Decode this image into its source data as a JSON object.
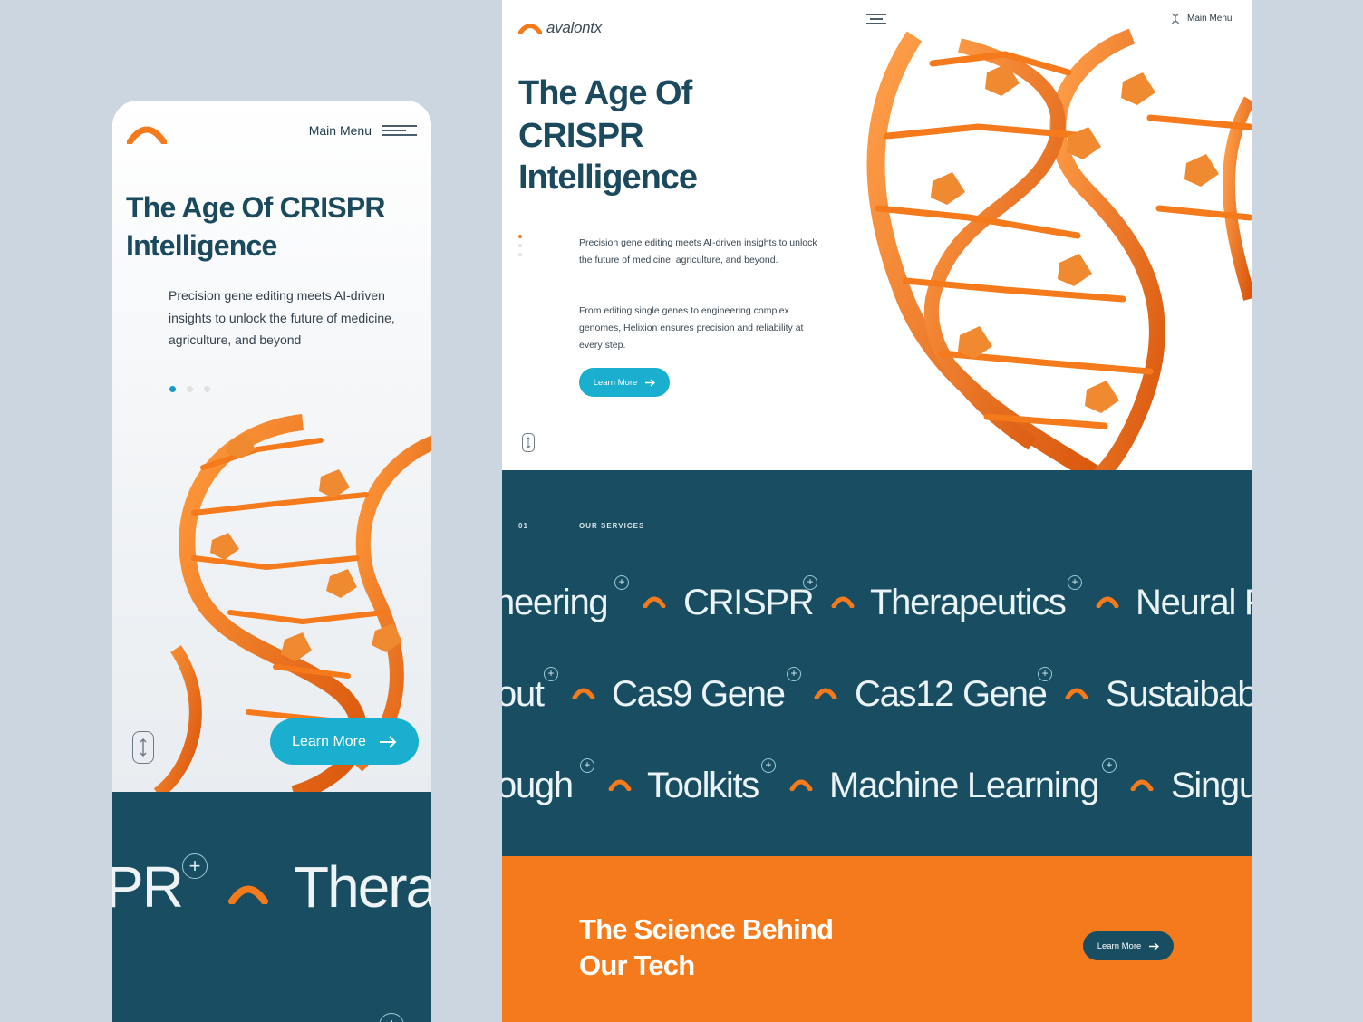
{
  "colors": {
    "orange": "#f47a1b",
    "teal_dark": "#184d62",
    "cyan": "#1aaecf",
    "heading": "#1b4a5e",
    "background": "#ccd6e0"
  },
  "mobile": {
    "logo_icon": "arch-logo-icon",
    "menu_label": "Main Menu",
    "menu_icon": "hamburger-icon",
    "title": "The Age Of CRISPR Intelligence",
    "description": "Precision gene editing meets AI-driven insights to unlock the future of medicine, agriculture, and beyond",
    "carousel_dots": 3,
    "carousel_active_index": 0,
    "scroll_icon": "scroll-updown-icon",
    "learn_more": "Learn More",
    "services_words": [
      "PR",
      "Thera"
    ]
  },
  "desktop": {
    "brand": "avalontx",
    "logo_icon": "arch-logo-icon",
    "menu_icon": "hamburger-icon",
    "main_menu_label": "Main Menu",
    "main_menu_icon": "dna-icon",
    "title": "The Age Of CRISPR Intelligence",
    "paragraph_1": "Precision gene editing meets AI-driven insights to unlock the future of medicine, agriculture, and beyond.",
    "paragraph_2": "From editing single genes to engineering complex genomes, Helixion ensures precision and reliability at every step.",
    "learn_more": "Learn More",
    "scroll_icon": "scroll-updown-icon",
    "services": {
      "number": "01",
      "label": "OUR SERVICES",
      "rows": [
        [
          "neering",
          "CRISPR",
          "Therapeutics",
          "Neural F"
        ],
        [
          "out",
          "Cas9 Gene",
          "Cas12 Gene",
          "Sustaibab"
        ],
        [
          "ough",
          "Toolkits",
          "Machine Learning",
          "Singu"
        ]
      ]
    },
    "science": {
      "title": "The Science Behind Our Tech",
      "button": "Learn More"
    }
  }
}
